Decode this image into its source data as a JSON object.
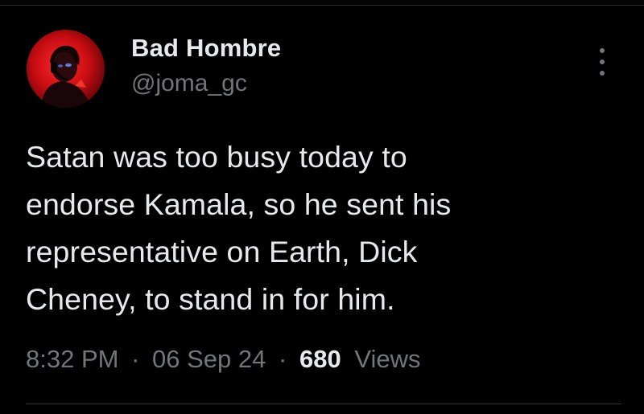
{
  "author": {
    "display_name": "Bad Hombre",
    "handle": "@joma_gc",
    "avatar_icon": "profile-avatar-red"
  },
  "tweet": {
    "lines": [
      "Satan was too busy today to",
      "endorse Kamala, so he sent his",
      "representative on Earth, Dick",
      "Cheney, to stand in for him."
    ]
  },
  "meta": {
    "time": "8:32 PM",
    "separator": "·",
    "date": "06 Sep 24",
    "views_count": "680",
    "views_label": "Views"
  },
  "icons": {
    "more": "more-options-icon"
  },
  "colors": {
    "background": "#000000",
    "primary_text": "#e7e9ea",
    "secondary_text": "#71767b",
    "avatar_accent": "#e0161c"
  }
}
